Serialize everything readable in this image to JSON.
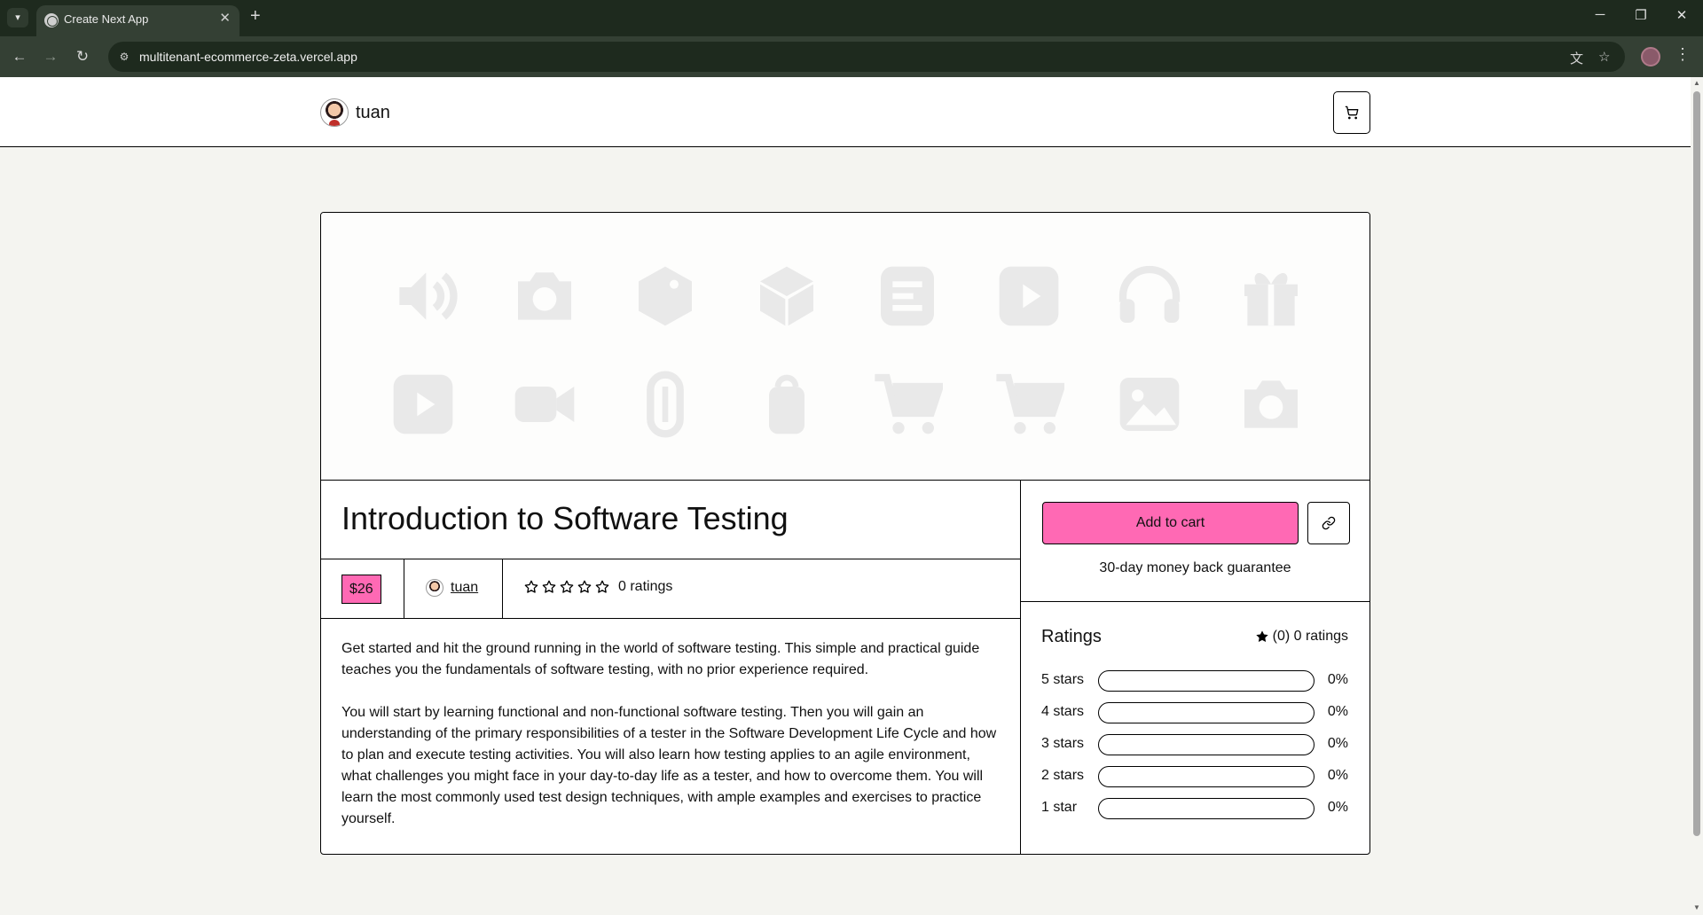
{
  "browser": {
    "tab_title": "Create Next App",
    "url": "multitenant-ecommerce-zeta.vercel.app"
  },
  "site": {
    "brand_name": "tuan"
  },
  "product": {
    "title": "Introduction to Software Testing",
    "price": "$26",
    "author": "tuan",
    "ratings_label": "0 ratings",
    "star_rating": 0,
    "description": [
      "Get started and hit the ground running in the world of software testing. This simple and practical guide teaches you the fundamentals of software testing, with no prior experience required.",
      "You will start by learning functional and non-functional software testing. Then you will gain an understanding of the primary responsibilities of a tester in the Software Development Life Cycle and how to plan and execute testing activities. You will also learn how testing applies to an agile environment, what challenges you might face in your day-to-day life as a tester, and how to overcome them. You will learn the most commonly used test design techniques, with ample examples and exercises to practice yourself."
    ]
  },
  "buy": {
    "add_to_cart": "Add to cart",
    "guarantee": "30-day money back guarantee"
  },
  "ratings": {
    "heading": "Ratings",
    "summary": "(0) 0 ratings",
    "rows": [
      {
        "label": "5 stars",
        "percent": "0%",
        "value": 0
      },
      {
        "label": "4 stars",
        "percent": "0%",
        "value": 0
      },
      {
        "label": "3 stars",
        "percent": "0%",
        "value": 0
      },
      {
        "label": "2 stars",
        "percent": "0%",
        "value": 0
      },
      {
        "label": "1 star",
        "percent": "0%",
        "value": 0
      }
    ]
  },
  "colors": {
    "accent": "#ff69b4",
    "page_bg": "#f4f4f0",
    "chrome_bg": "#1e2a1e"
  },
  "hero_icons": [
    "speaker-icon",
    "camera-icon",
    "tag-icon",
    "box-icon",
    "document-icon",
    "play-icon",
    "headphones-icon",
    "gift-icon",
    "play-icon",
    "video-icon",
    "paperclip-icon",
    "bag-icon",
    "cart-icon",
    "cart-icon",
    "image-icon",
    "camera-icon"
  ]
}
